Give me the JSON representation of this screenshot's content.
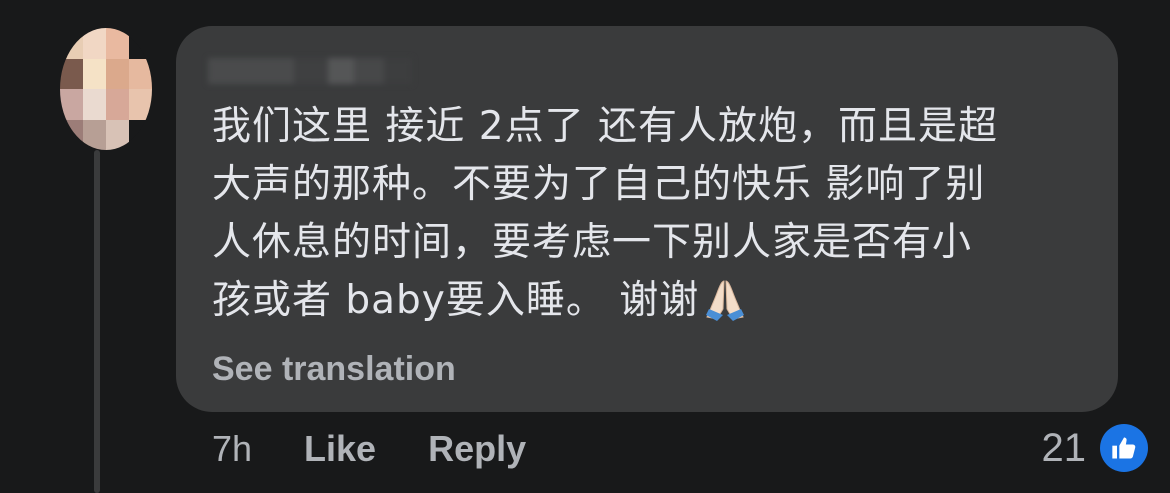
{
  "comment": {
    "lines": [
      "我们这里 接近 2点了 还有人放炮，而且是超",
      "大声的那种。不要为了自己的快乐 影响了别",
      "人休息的时间，要考虑一下别人家是否有小",
      "孩或者 baby要入睡。 谢谢"
    ],
    "emoji": "folded-hands-icon",
    "see_translation": "See translation"
  },
  "actions": {
    "time": "7h",
    "like": "Like",
    "reply": "Reply"
  },
  "reactions": {
    "count": "21",
    "icon": "thumbs-up-icon",
    "color": "#1b74e4"
  },
  "colors": {
    "background": "#18191a",
    "bubble": "#3a3b3c",
    "text": "#e4e6eb",
    "secondary": "#b0b3b8"
  }
}
